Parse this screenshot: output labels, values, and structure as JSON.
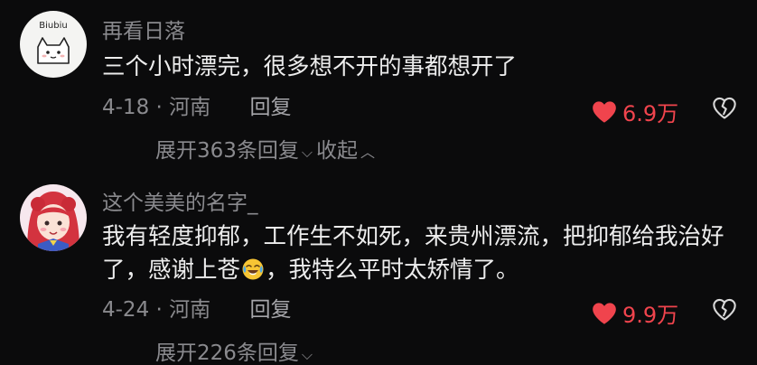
{
  "comments": [
    {
      "username": "再看日落",
      "avatar_label": "Biubiu",
      "text": "三个小时漂完，很多想不开的事都想开了",
      "date": "4-18",
      "separator": "·",
      "location": "河南",
      "reply_label": "回复",
      "likes": "6.9万",
      "expand_label": "展开363条回复",
      "collapse_label": "收起"
    },
    {
      "username": "这个美美的名字_",
      "text_part1": "我有轻度抑郁，工作生不如死，来贵州漂流，把抑郁给我治好了，感谢上苍",
      "emoji_name": "laugh-cry-emoji",
      "text_part2": "，我特么平时太矫情了。",
      "date": "4-24",
      "separator": "·",
      "location": "河南",
      "reply_label": "回复",
      "likes": "9.9万",
      "expand_label": "展开226条回复"
    }
  ],
  "colors": {
    "background": "#0b0b0c",
    "like_red": "#f0444d",
    "muted_text": "#8a8a8e"
  }
}
